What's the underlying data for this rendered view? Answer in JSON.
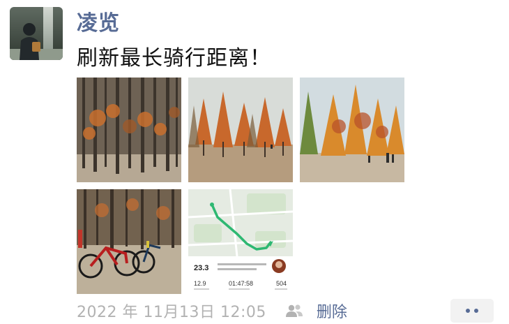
{
  "post": {
    "username": "凌览",
    "text": "刷新最长骑行距离！",
    "timestamp": "2022 年 11月13日 12:05",
    "delete_label": "删除"
  },
  "icons": {
    "privacy": "people-icon",
    "more": "more-dots-icon"
  },
  "photos": [
    {
      "label": "forest-1"
    },
    {
      "label": "forest-2"
    },
    {
      "label": "forest-3"
    },
    {
      "label": "bikes"
    },
    {
      "label": "route-map"
    }
  ],
  "ride_summary": {
    "distance": "23.3",
    "stat_1": "12.9",
    "duration": "01:47:58",
    "stat_3": "504"
  },
  "colors": {
    "username": "#576b95",
    "route": "#2eb872",
    "timestamp": "#b2b2b2"
  }
}
